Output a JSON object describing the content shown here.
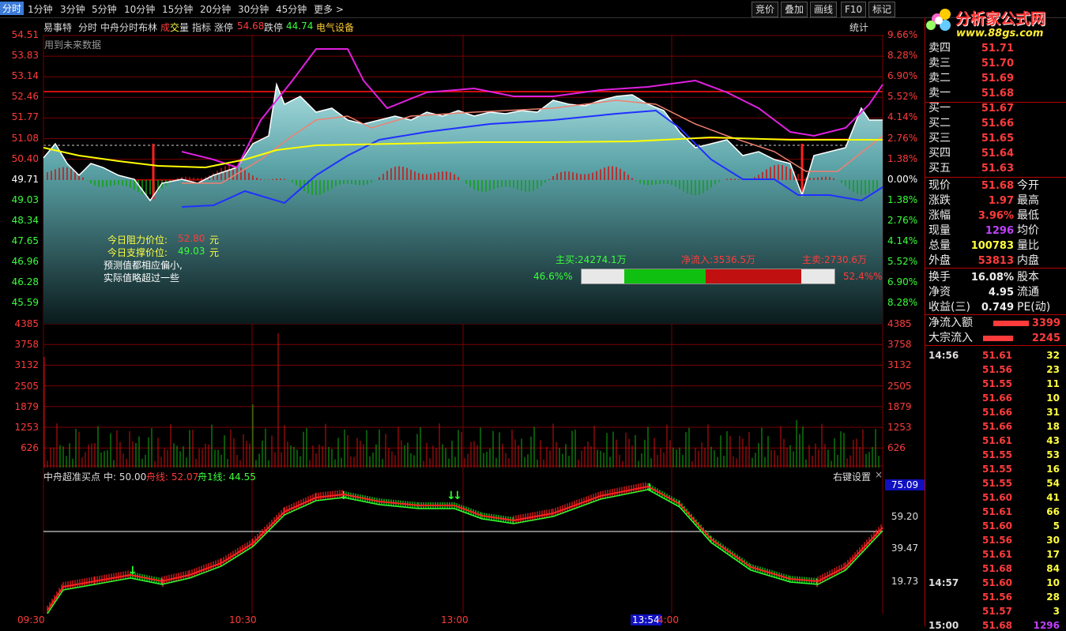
{
  "periods": [
    "分时",
    "1分钟",
    "3分钟",
    "5分钟",
    "10分钟",
    "15分钟",
    "20分钟",
    "30分钟",
    "45分钟",
    "更多 >"
  ],
  "tools": [
    "竞价",
    "叠加",
    "画线",
    "F10",
    "标记"
  ],
  "logo": {
    "title": "分析家公式网",
    "url": "www.88gs.com"
  },
  "header": {
    "name": "易事特",
    "view": "分时",
    "indicator": "中舟分时布林",
    "vol_a": "成",
    "vol_b": "交",
    "vol_c": "量",
    "idx": "指标",
    "limit_up_label": "涨停",
    "limit_up": "54.68",
    "limit_down_label": "跌停",
    "limit_down": "44.74",
    "sector": "电气设备",
    "stats": "统计",
    "future_note": "用到未来数据"
  },
  "price_axis_left": [
    "54.51",
    "53.83",
    "53.14",
    "52.46",
    "51.77",
    "51.08",
    "50.40",
    "49.71",
    "49.03",
    "48.34",
    "47.65",
    "46.96",
    "46.28",
    "45.59"
  ],
  "pct_axis_right": [
    "9.66%",
    "8.28%",
    "6.90%",
    "5.52%",
    "4.14%",
    "2.76%",
    "1.38%",
    "0.00%",
    "1.38%",
    "2.76%",
    "4.14%",
    "5.52%",
    "6.90%",
    "8.28%"
  ],
  "vol_axis": [
    "4385",
    "3758",
    "3132",
    "2505",
    "1879",
    "1253",
    "626"
  ],
  "notes": {
    "resist_label": "今日阻力价位:",
    "resist_value": "52.80",
    "unit": "元",
    "support_label": "今日支撑价位:",
    "support_value": "49.03",
    "note1": "预测值都相应偏小,",
    "note2": "实际值略超过一些"
  },
  "flow": {
    "buy_label": "主买:24274.1万",
    "net_label": "净流入:3536.5万",
    "sell_label": "主卖:2730.6万",
    "left_pct": "46.6%%",
    "right_pct": "52.4%%",
    "segments": [
      0.17,
      0.32,
      0.38,
      0.13
    ]
  },
  "sub": {
    "title": "中舟超准买点",
    "mid_label": "中: 50.00",
    "zhou_label": "舟线: 52.07",
    "zhou1_label": "舟1线: 44.55",
    "right_menu": "右键设置",
    "axis": [
      "75.09",
      "59.20",
      "39.47",
      "19.73"
    ]
  },
  "time_axis": [
    "09:30",
    "10:30",
    "13:00",
    "13:54",
    "4:00"
  ],
  "orderbook": [
    {
      "label": "卖四",
      "price": "51.71"
    },
    {
      "label": "卖三",
      "price": "51.70"
    },
    {
      "label": "卖二",
      "price": "51.69"
    },
    {
      "label": "卖一",
      "price": "51.68"
    },
    {
      "label": "买一",
      "price": "51.67"
    },
    {
      "label": "买二",
      "price": "51.66"
    },
    {
      "label": "买三",
      "price": "51.65"
    },
    {
      "label": "买四",
      "price": "51.64"
    },
    {
      "label": "买五",
      "price": "51.63"
    }
  ],
  "quote": [
    {
      "l": "现价",
      "v": "51.68",
      "c": "#ff3b3b",
      "r": "今开"
    },
    {
      "l": "涨跌",
      "v": "1.97",
      "c": "#ff3b3b",
      "r": "最高"
    },
    {
      "l": "涨幅",
      "v": "3.96%",
      "c": "#ff3b3b",
      "r": "最低"
    },
    {
      "l": "现量",
      "v": "1296",
      "c": "#c040ff",
      "r": "均价"
    },
    {
      "l": "总量",
      "v": "100783",
      "c": "#ffff40",
      "r": "量比"
    },
    {
      "l": "外盘",
      "v": "53813",
      "c": "#ff3b3b",
      "r": "内盘"
    }
  ],
  "quote2": [
    {
      "l": "换手",
      "v": "16.08%",
      "c": "#eee",
      "r": "股本"
    },
    {
      "l": "净资",
      "v": "4.95",
      "c": "#eee",
      "r": "流通"
    },
    {
      "l": "收益(三)",
      "v": "0.749",
      "c": "#eee",
      "r": "PE(动)"
    }
  ],
  "inflow": [
    {
      "l": "净流入额",
      "v": "3399"
    },
    {
      "l": "大宗流入",
      "v": "2245"
    }
  ],
  "ticks_group1_time": "14:56",
  "ticks_group1": [
    [
      "51.61",
      "32"
    ],
    [
      "51.56",
      "23"
    ],
    [
      "51.55",
      "11"
    ],
    [
      "51.66",
      "10"
    ],
    [
      "51.66",
      "31"
    ],
    [
      "51.66",
      "18"
    ],
    [
      "51.61",
      "43"
    ],
    [
      "51.55",
      "53"
    ],
    [
      "51.55",
      "16"
    ],
    [
      "51.55",
      "54"
    ],
    [
      "51.60",
      "41"
    ],
    [
      "51.61",
      "66"
    ],
    [
      "51.60",
      "5"
    ],
    [
      "51.56",
      "30"
    ],
    [
      "51.61",
      "17"
    ],
    [
      "51.68",
      "84"
    ]
  ],
  "ticks_group2_time": "14:57",
  "ticks_group2": [
    [
      "51.60",
      "10"
    ],
    [
      "51.56",
      "28"
    ],
    [
      "51.57",
      "3"
    ]
  ],
  "ticks_group3_time": "15:00",
  "ticks_group3": [
    [
      "51.68",
      "1296"
    ]
  ],
  "colors": {
    "up": "#ff3b3b",
    "down": "#3bff3b",
    "grid": "#8b0000",
    "price_line": "#ffffff",
    "avg_line": "#ffff00"
  }
}
